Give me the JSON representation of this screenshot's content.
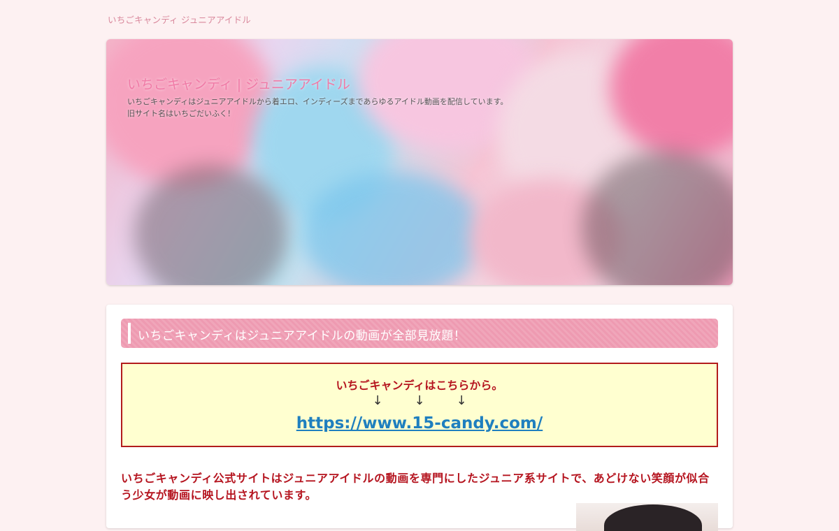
{
  "site": {
    "top_label": "いちごキャンディ ジュニアアイドル"
  },
  "hero": {
    "title": "いちごキャンディ | ジュニアアイドル",
    "description": "いちごキャンディはジュニアアイドルから着エロ、インディーズまであらゆるアイドル動画を配信しています。旧サイト名はいちごだいふく！",
    "accent_color": "#f07aa6"
  },
  "article": {
    "heading": "いちごキャンディはジュニアアイドルの動画が全部見放題！",
    "notice": {
      "title": "いちごキャンディはこちらから。",
      "arrows": [
        "↓",
        "↓",
        "↓"
      ],
      "link_text": "https://www.15-candy.com/"
    },
    "intro": "いちごキャンディ公式サイトはジュニアアイドルの動画を専門にしたジュニア系サイトで、あどけない笑顔が似合う少女が動画に映し出されています。"
  },
  "colors": {
    "page_bg": "#fdf1f2",
    "heading_bg": "#ee9ab1",
    "notice_border": "#b21c1c",
    "notice_bg": "#ffffd0",
    "emphasis_text": "#b5141f",
    "link": "#1f7fbf"
  }
}
